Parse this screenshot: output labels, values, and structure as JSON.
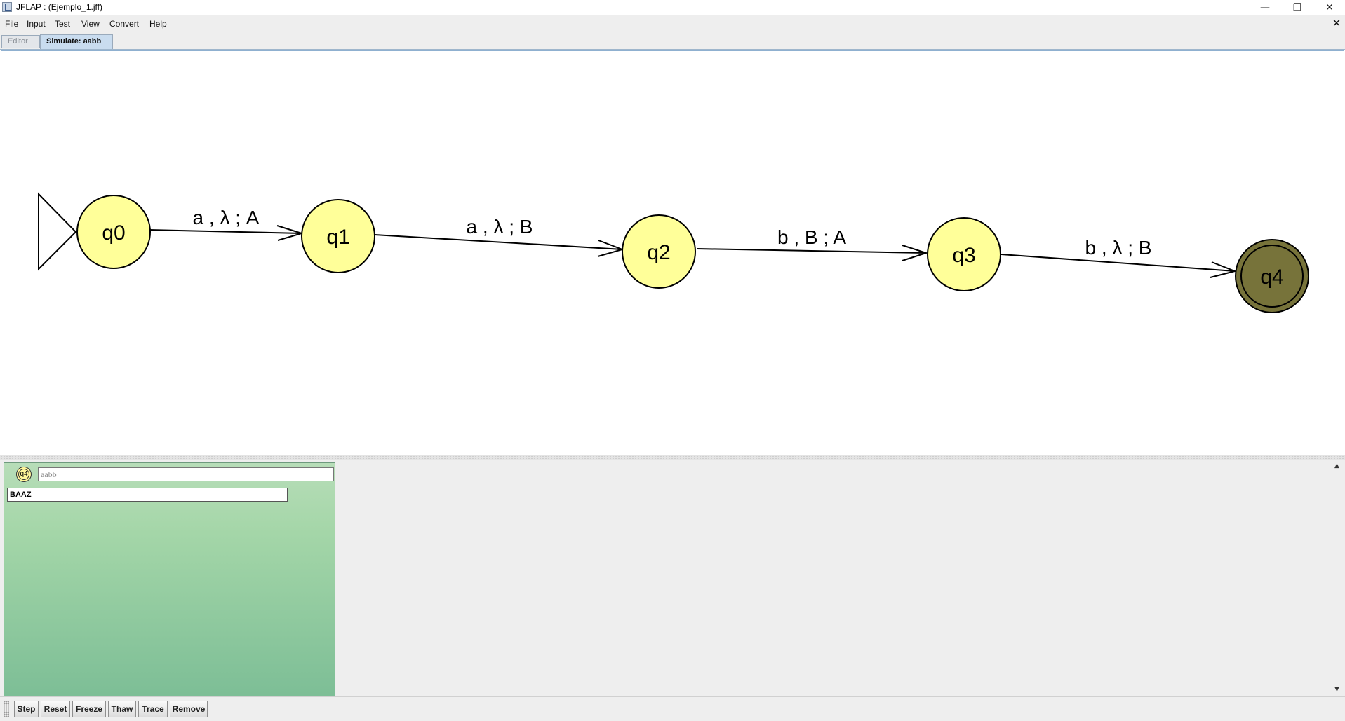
{
  "window": {
    "title": "JFLAP : (Ejemplo_1.jff)",
    "minimize_glyph": "—",
    "maximize_glyph": "❐",
    "close_glyph": "✕"
  },
  "menu": {
    "items": [
      "File",
      "Input",
      "Test",
      "View",
      "Convert",
      "Help"
    ],
    "close_glyph": "✕"
  },
  "tabs": [
    {
      "label": "Editor",
      "active": false
    },
    {
      "label": "Simulate: aabb",
      "active": true
    }
  ],
  "automaton": {
    "initial_state": "q0",
    "states": [
      {
        "id": "q0",
        "final": false,
        "current": false
      },
      {
        "id": "q1",
        "final": false,
        "current": false
      },
      {
        "id": "q2",
        "final": false,
        "current": false
      },
      {
        "id": "q3",
        "final": false,
        "current": false
      },
      {
        "id": "q4",
        "final": true,
        "current": true
      }
    ],
    "transitions": [
      {
        "from": "q0",
        "to": "q1",
        "label": "a , λ ; A"
      },
      {
        "from": "q1",
        "to": "q2",
        "label": "a , λ ; B"
      },
      {
        "from": "q2",
        "to": "q3",
        "label": "b , B ; A"
      },
      {
        "from": "q3",
        "to": "q4",
        "label": "b , λ ; B"
      }
    ],
    "colors": {
      "state_fill": "#ffff99",
      "current_state_fill": "#77733a",
      "stroke": "#000000"
    }
  },
  "configuration": {
    "state": "q4",
    "input": "aabb",
    "stack": "BAAZ"
  },
  "scrollbar": {
    "up_glyph": "▲",
    "down_glyph": "▼"
  },
  "toolbar": {
    "buttons": [
      "Step",
      "Reset",
      "Freeze",
      "Thaw",
      "Trace",
      "Remove"
    ]
  }
}
